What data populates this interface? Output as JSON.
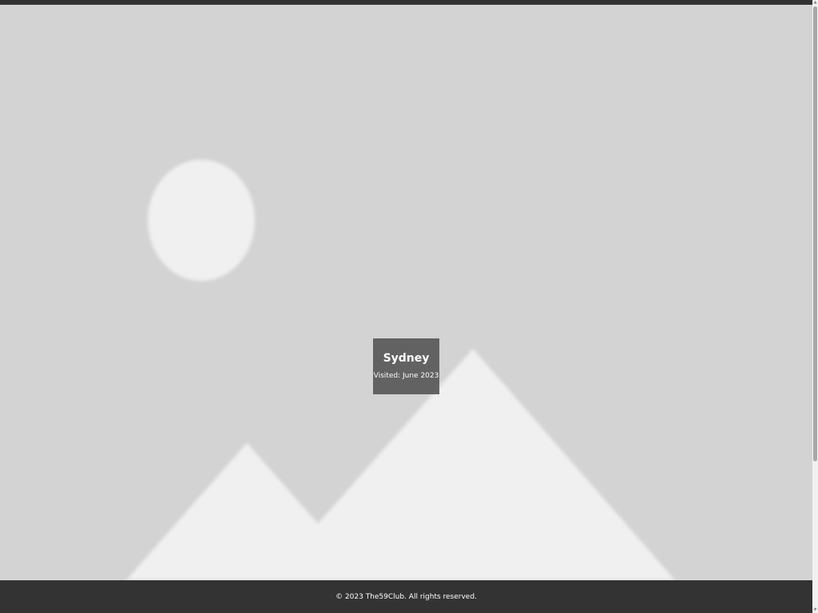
{
  "photo": {
    "title": "Sydney",
    "subtitle": "Visited: June 2023",
    "placeholder_icon": "image-placeholder-icon"
  },
  "footer": {
    "text": "© 2023 The59Club. All rights reserved."
  },
  "colors": {
    "background": "#d3d3d3",
    "placeholder_shape": "#f0f0f0",
    "caption_bg": "#555555",
    "bar": "#333333"
  }
}
